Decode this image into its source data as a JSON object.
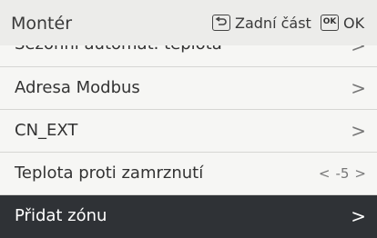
{
  "header": {
    "title": "Montér",
    "back_label": "Zadní část",
    "ok_label": "OK",
    "ok_key": "OK"
  },
  "menu": {
    "items": [
      {
        "label": "Sezónní automat. teplota",
        "chevron": ">"
      },
      {
        "label": "Adresa Modbus",
        "chevron": ">"
      },
      {
        "label": "CN_EXT",
        "chevron": ">"
      },
      {
        "label": "Teplota proti zamrznutí",
        "value": "-5",
        "left_arrow": "<",
        "right_arrow": ">"
      },
      {
        "label": "Přidat zónu",
        "chevron": ">"
      }
    ],
    "selected_index": 4
  }
}
